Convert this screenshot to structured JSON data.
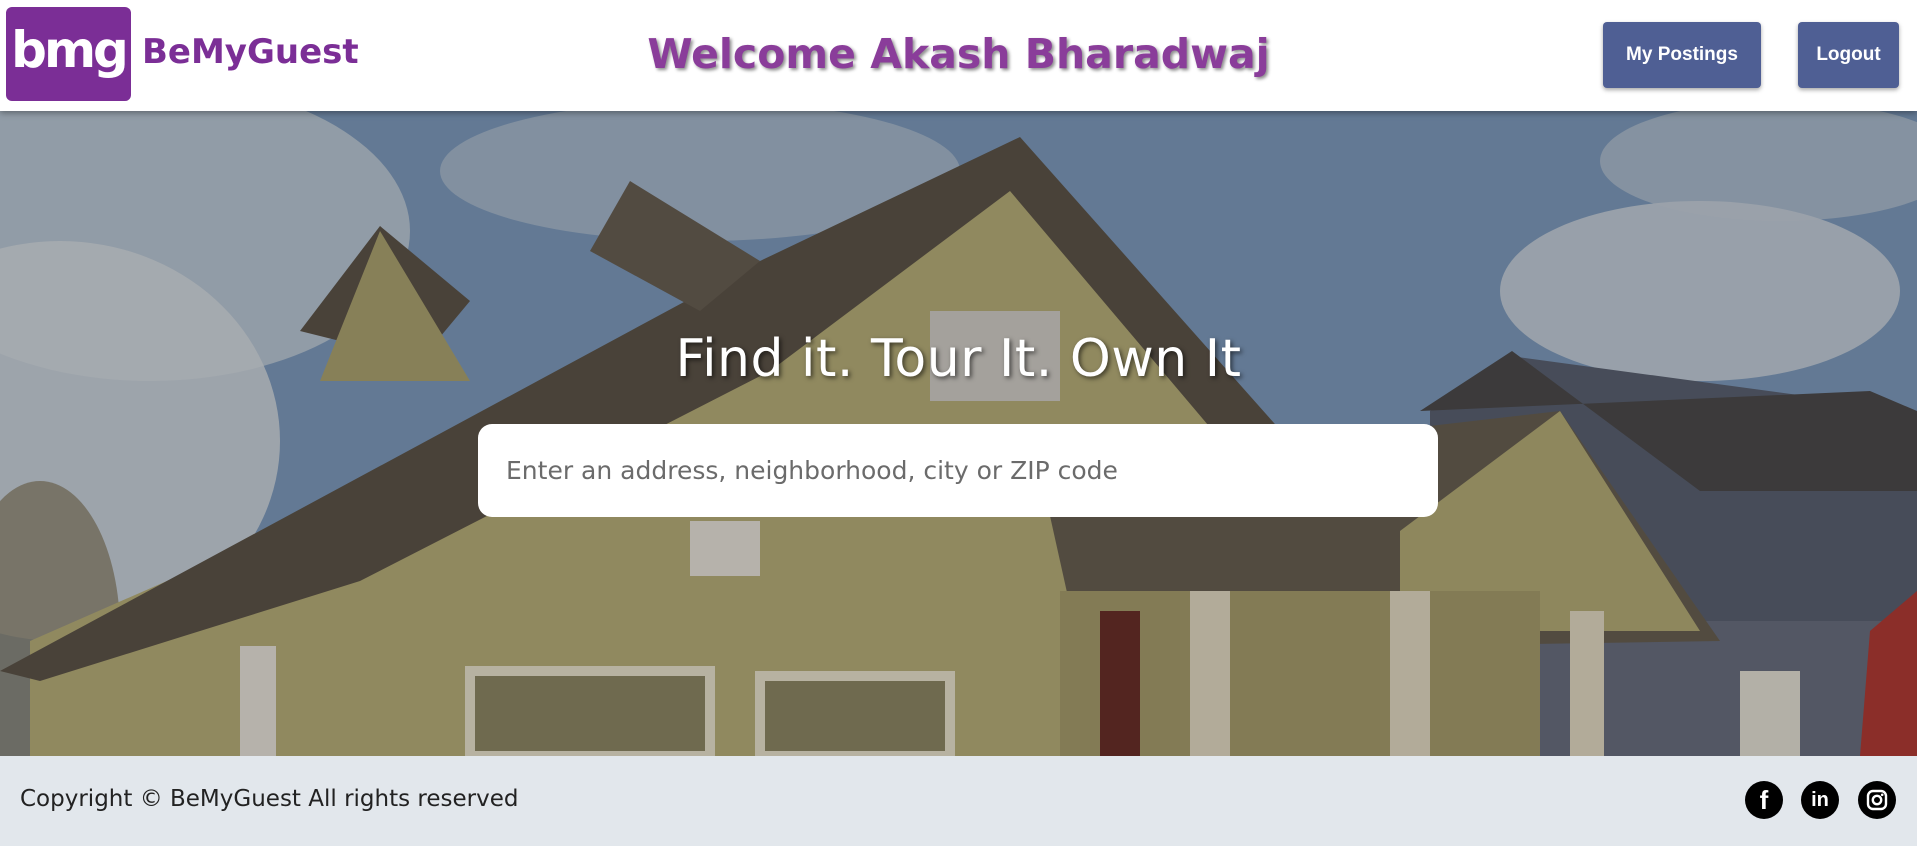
{
  "header": {
    "logo_text": "bmg",
    "brand_name": "BeMyGuest",
    "welcome_text": "Welcome Akash Bharadwaj",
    "my_postings_label": "My Postings",
    "logout_label": "Logout"
  },
  "hero": {
    "tagline": "Find it. Tour It. Own It",
    "search_placeholder": "Enter an address, neighborhood, city or ZIP code",
    "search_value": ""
  },
  "footer": {
    "copyright": "Copyright © BeMyGuest All rights reserved",
    "social_icons": [
      "facebook-icon",
      "linkedin-icon",
      "instagram-icon"
    ],
    "facebook_glyph": "f",
    "linkedin_glyph": "in"
  },
  "colors": {
    "brand_purple": "#7b2e96",
    "button_blue": "#4f5f94",
    "footer_bg": "#e2e7ec"
  }
}
